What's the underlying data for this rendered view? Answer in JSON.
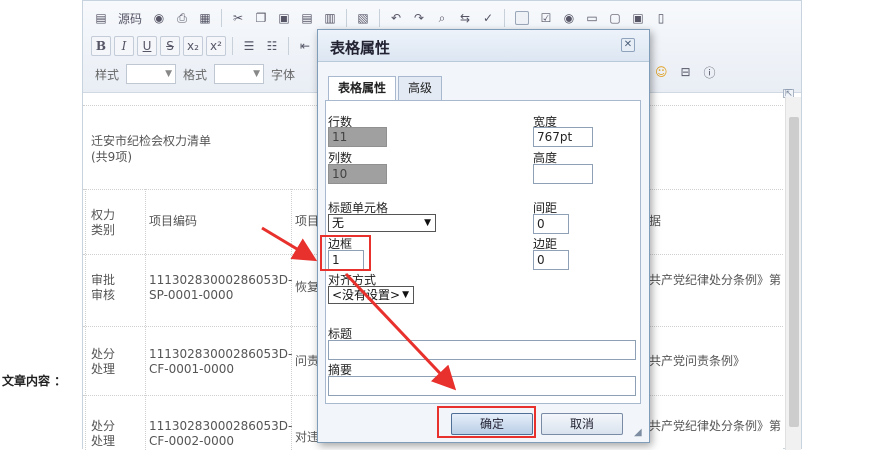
{
  "side_label": "文章内容 ：",
  "toolbar": {
    "source_label": "源码",
    "bold": "B",
    "italic": "I",
    "underline": "U",
    "strike": "S",
    "subscript": "x₂",
    "superscript": "x²",
    "style_label": "样式",
    "format_label": "格式",
    "font_label": "字体"
  },
  "content": {
    "table_title_line1": "迁安市纪检会权力清单",
    "table_title_line2": "(共9项)",
    "headers": {
      "type_l1": "权力",
      "type_l2": "类别",
      "code": "项目编码",
      "name": "项目",
      "basis": "据"
    },
    "rows": [
      {
        "type_l1": "审批",
        "type_l2": "审核",
        "code_l1": "11130283000286053D-",
        "code_l2": "SP-0001-0000",
        "name": "恢复",
        "basis": "共产党纪律处分条例》第"
      },
      {
        "type_l1": "处分",
        "type_l2": "处理",
        "code_l1": "11130283000286053D-",
        "code_l2": "CF-0001-0000",
        "name": "问责",
        "basis": "共产党问责条例》"
      },
      {
        "type_l1": "处分",
        "type_l2": "处理",
        "code_l1": "11130283000286053D-",
        "code_l2": "CF-0002-0000",
        "name": "对违",
        "basis": "共产党纪律处分条例》第"
      }
    ]
  },
  "dialog": {
    "title": "表格属性",
    "tabs": [
      {
        "label": "表格属性",
        "active": true
      },
      {
        "label": "高级",
        "active": false
      }
    ],
    "rows_label": "行数",
    "rows_value": "11",
    "cols_label": "列数",
    "cols_value": "10",
    "width_label": "宽度",
    "width_value": "767pt",
    "height_label": "高度",
    "height_value": "",
    "header_label": "标题单元格",
    "header_value": "无",
    "spacing_label": "间距",
    "spacing_value": "0",
    "border_label": "边框",
    "border_value": "1",
    "padding_label": "边距",
    "padding_value": "0",
    "align_label": "对齐方式",
    "align_value": "<没有设置>",
    "caption_label": "标题",
    "caption_value": "",
    "summary_label": "摘要",
    "summary_value": "",
    "ok_label": "确定",
    "cancel_label": "取消"
  },
  "annotation_color": "#e8302c"
}
